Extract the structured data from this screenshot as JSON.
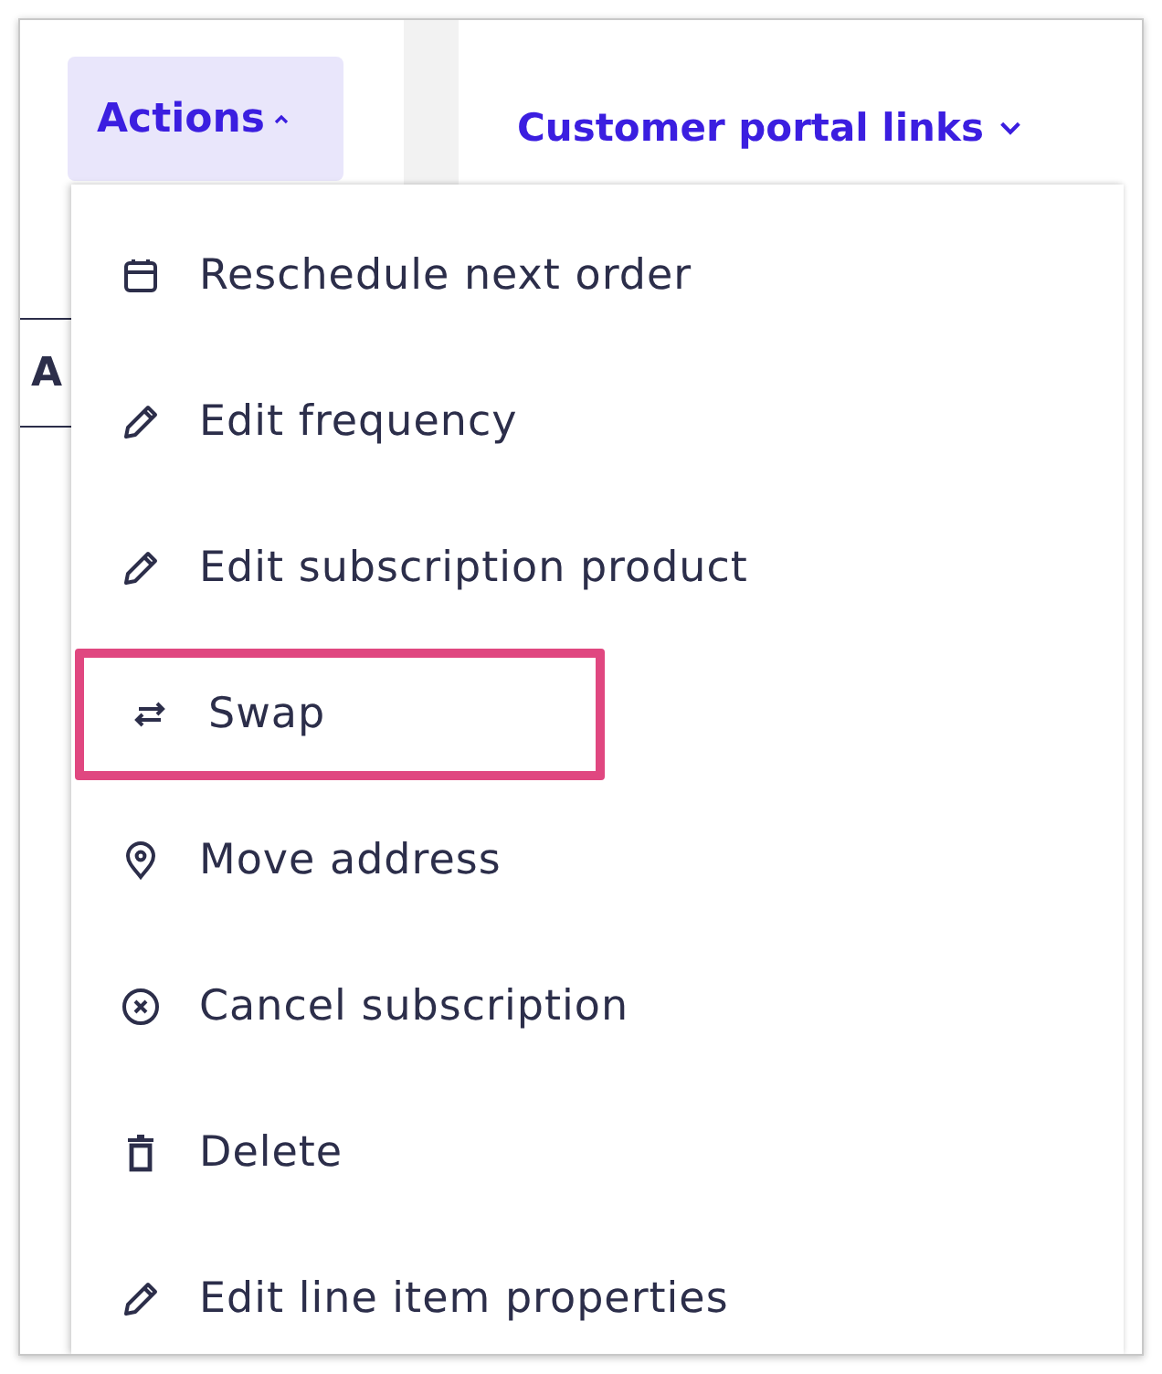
{
  "actions_button": {
    "label": "Actions",
    "expanded": true
  },
  "portal_links": {
    "label": "Customer portal links",
    "expanded": false
  },
  "background_tab": {
    "label": "A"
  },
  "menu": {
    "items": [
      {
        "kind": "calendar",
        "label": "Reschedule next order",
        "highlighted": false
      },
      {
        "kind": "pencil",
        "label": "Edit frequency",
        "highlighted": false
      },
      {
        "kind": "pencil",
        "label": "Edit subscription product",
        "highlighted": false
      },
      {
        "kind": "swap",
        "label": "Swap",
        "highlighted": true
      },
      {
        "kind": "pin",
        "label": "Move address",
        "highlighted": false
      },
      {
        "kind": "cancel",
        "label": "Cancel subscription",
        "highlighted": false
      },
      {
        "kind": "trash",
        "label": "Delete",
        "highlighted": false
      },
      {
        "kind": "pencil",
        "label": "Edit line item properties",
        "highlighted": false
      }
    ]
  }
}
